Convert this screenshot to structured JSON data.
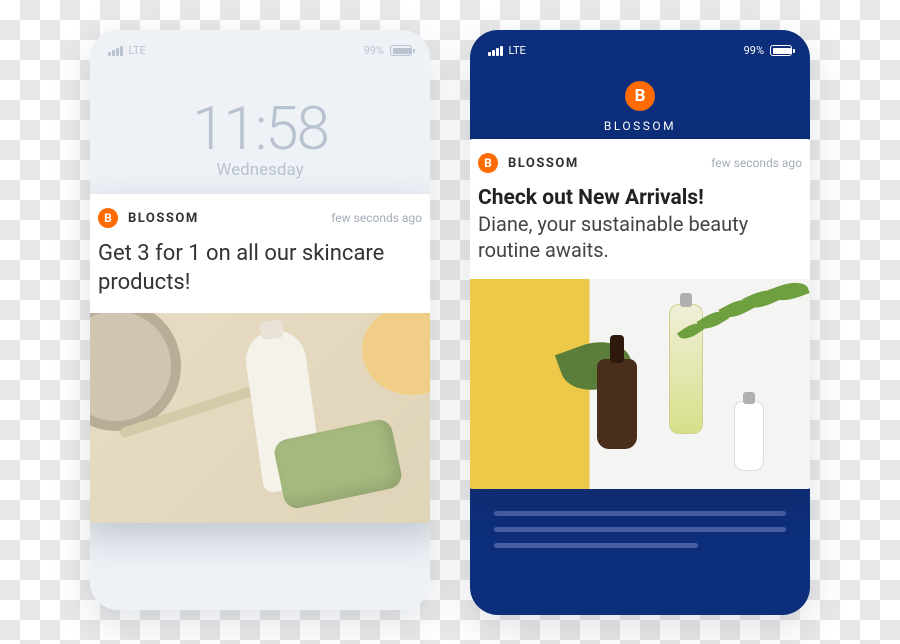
{
  "phone_left": {
    "status": {
      "network": "LTE",
      "battery": "99%"
    },
    "lock": {
      "time": "11:58",
      "day": "Wednesday"
    },
    "notification": {
      "app_letter": "B",
      "app_name": "BLOSSOM",
      "timestamp": "few seconds ago",
      "message": "Get 3 for 1 on all our skincare products!"
    }
  },
  "phone_right": {
    "status": {
      "network": "LTE",
      "battery": "99%"
    },
    "header": {
      "logo_letter": "B",
      "app_name": "BLOSSOM"
    },
    "notification": {
      "app_letter": "B",
      "app_name": "BLOSSOM",
      "timestamp": "few seconds ago",
      "title": "Check out New Arrivals!",
      "message": "Diane, your sustainable beauty routine awaits."
    }
  }
}
